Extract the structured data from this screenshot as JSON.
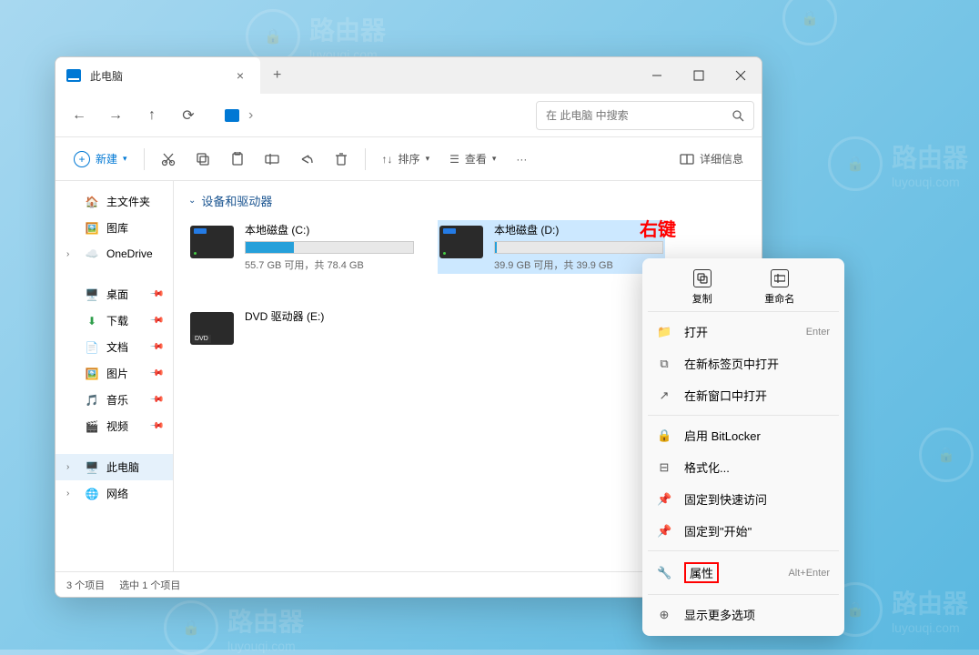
{
  "watermark": {
    "text": "路由器",
    "sub": "luyouqi.com"
  },
  "window": {
    "tab_title": "此电脑",
    "search_placeholder": "在 此电脑 中搜索",
    "toolbar": {
      "new": "新建",
      "sort": "排序",
      "view": "查看",
      "details": "详细信息"
    }
  },
  "sidebar": {
    "home": "主文件夹",
    "gallery": "图库",
    "onedrive": "OneDrive",
    "desktop": "桌面",
    "downloads": "下载",
    "documents": "文档",
    "pictures": "图片",
    "music": "音乐",
    "videos": "视频",
    "this_pc": "此电脑",
    "network": "网络"
  },
  "content": {
    "section": "设备和驱动器",
    "drives": [
      {
        "name": "本地磁盘 (C:)",
        "text": "55.7 GB 可用，共 78.4 GB",
        "fill": 29
      },
      {
        "name": "本地磁盘 (D:)",
        "text": "39.9 GB 可用，共 39.9 GB",
        "fill": 1
      }
    ],
    "dvd": "DVD 驱动器 (E:)"
  },
  "annotation": "右键",
  "statusbar": {
    "count": "3 个项目",
    "selected": "选中 1 个项目"
  },
  "context_menu": {
    "copy": "复制",
    "rename": "重命名",
    "items": [
      {
        "icon": "folder",
        "label": "打开",
        "shortcut": "Enter"
      },
      {
        "icon": "tab",
        "label": "在新标签页中打开",
        "shortcut": ""
      },
      {
        "icon": "window",
        "label": "在新窗口中打开",
        "shortcut": ""
      },
      {
        "sep": true
      },
      {
        "icon": "lock",
        "label": "启用 BitLocker",
        "shortcut": ""
      },
      {
        "icon": "format",
        "label": "格式化...",
        "shortcut": ""
      },
      {
        "icon": "pin",
        "label": "固定到快速访问",
        "shortcut": ""
      },
      {
        "icon": "pin",
        "label": "固定到\"开始\"",
        "shortcut": ""
      },
      {
        "sep": true
      },
      {
        "icon": "wrench",
        "label": "属性",
        "shortcut": "Alt+Enter",
        "highlight": true
      },
      {
        "sep": true
      },
      {
        "icon": "more",
        "label": "显示更多选项",
        "shortcut": ""
      }
    ]
  }
}
